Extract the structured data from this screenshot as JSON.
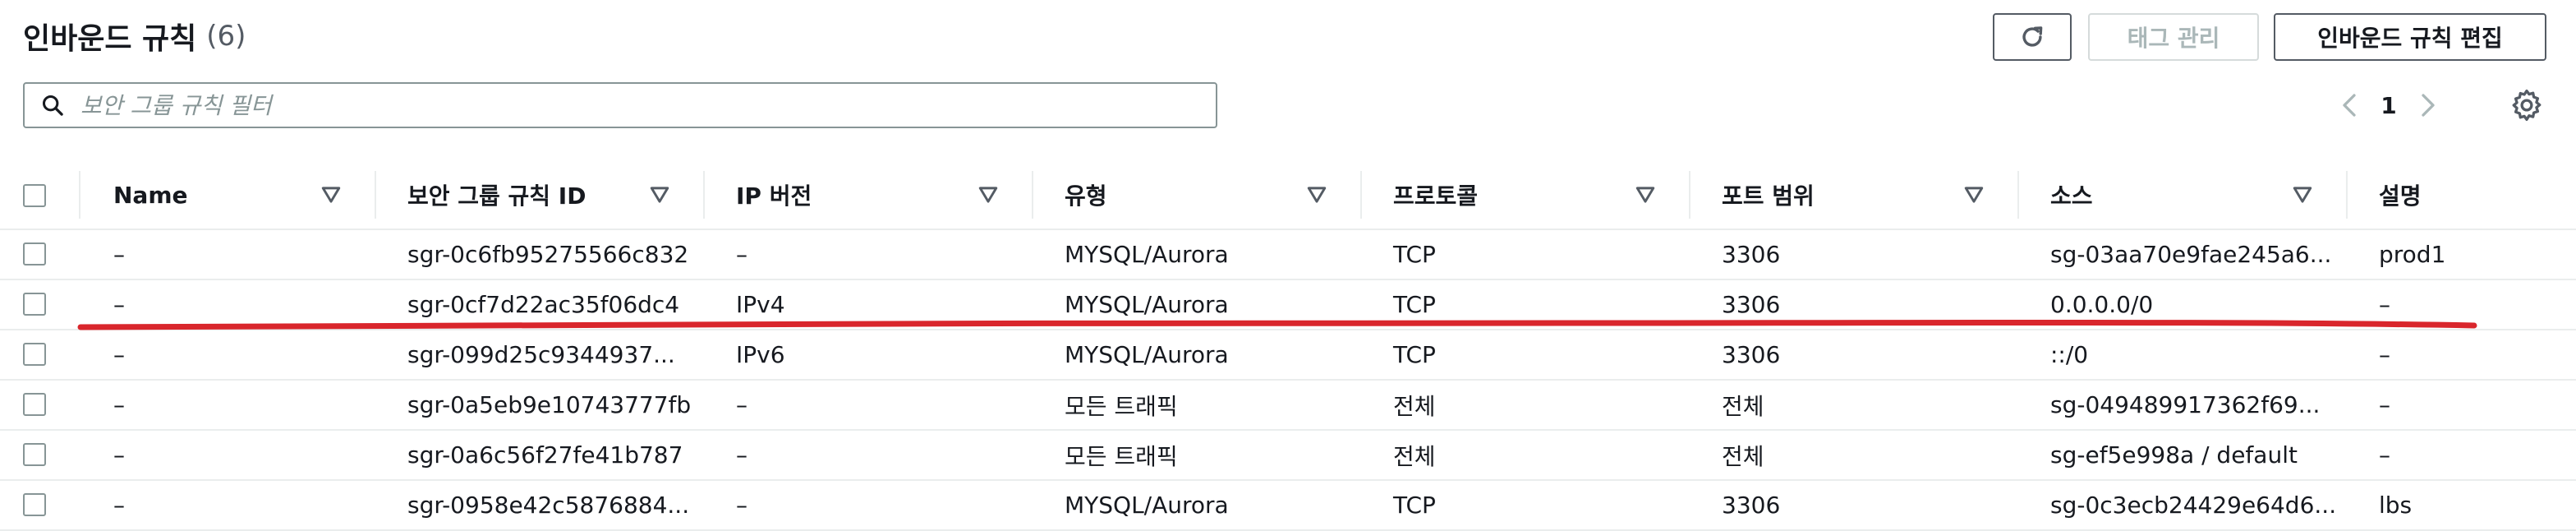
{
  "header": {
    "title": "인바운드 규칙",
    "count": "(6)"
  },
  "toolbar": {
    "refresh_icon": "refresh-icon",
    "manage_tags_label": "태그 관리",
    "edit_rules_label": "인바운드 규칙 편집"
  },
  "search": {
    "placeholder": "보안 그룹 규칙 필터",
    "value": "",
    "icon": "search-icon"
  },
  "pagination": {
    "current_page": "1",
    "prev_icon": "chevron-left-icon",
    "next_icon": "chevron-right-icon",
    "settings_icon": "gear-icon"
  },
  "table": {
    "columns": [
      "Name",
      "보안 그룹 규칙 ID",
      "IP 버전",
      "유형",
      "프로토콜",
      "포트 범위",
      "소스",
      "설명"
    ],
    "rows": [
      {
        "name": "–",
        "rule_id": "sgr-0c6fb95275566c832",
        "ip_version": "–",
        "type": "MYSQL/Aurora",
        "protocol": "TCP",
        "port_range": "3306",
        "source": "sg-03aa70e9fae245a6...",
        "description": "prod1"
      },
      {
        "name": "–",
        "rule_id": "sgr-0cf7d22ac35f06dc4",
        "ip_version": "IPv4",
        "type": "MYSQL/Aurora",
        "protocol": "TCP",
        "port_range": "3306",
        "source": "0.0.0.0/0",
        "description": "–"
      },
      {
        "name": "–",
        "rule_id": "sgr-099d25c9344937...",
        "ip_version": "IPv6",
        "type": "MYSQL/Aurora",
        "protocol": "TCP",
        "port_range": "3306",
        "source": "::/0",
        "description": "–"
      },
      {
        "name": "–",
        "rule_id": "sgr-0a5eb9e10743777fb",
        "ip_version": "–",
        "type": "모든 트래픽",
        "protocol": "전체",
        "port_range": "전체",
        "source": "sg-049489917362f69...",
        "description": "–"
      },
      {
        "name": "–",
        "rule_id": "sgr-0a6c56f27fe41b787",
        "ip_version": "–",
        "type": "모든 트래픽",
        "protocol": "전체",
        "port_range": "전체",
        "source": "sg-ef5e998a / default",
        "description": "–"
      },
      {
        "name": "–",
        "rule_id": "sgr-0958e42c5876884...",
        "ip_version": "–",
        "type": "MYSQL/Aurora",
        "protocol": "TCP",
        "port_range": "3306",
        "source": "sg-0c3ecb24429e64d6...",
        "description": "lbs"
      }
    ]
  },
  "colors": {
    "annotation_underline": "#d9262c",
    "border": "#879596",
    "divider": "#eaeded",
    "disabled_text": "#aab7b8"
  }
}
